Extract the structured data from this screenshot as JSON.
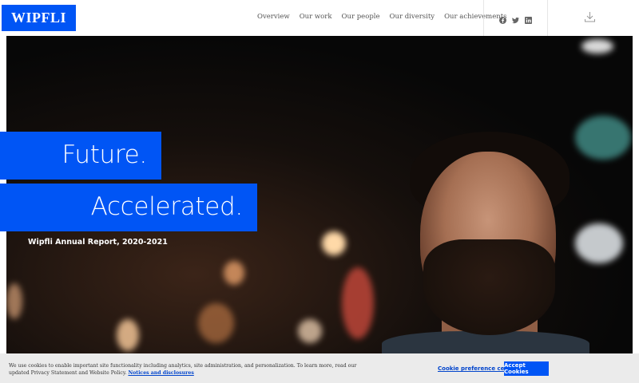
{
  "header": {
    "logo": "WIPFLI",
    "nav": [
      "Overview",
      "Our work",
      "Our people",
      "Our diversity",
      "Our achievements"
    ],
    "social_icons": [
      "facebook-icon",
      "twitter-icon",
      "linkedin-icon"
    ],
    "download_icon": "download-icon"
  },
  "hero": {
    "line1": "Future.",
    "line2": "Accelerated.",
    "subtitle": "Wipfli Annual Report, 2020-2021"
  },
  "cookie": {
    "text": "We use cookies to enable important site functionality including analytics, site administration, and personalization. To learn more, read our updated Privacy Statement and Website Policy.",
    "link": "Notices and disclosures",
    "preference": "Cookie preference center",
    "accept": "Accept Cookies"
  },
  "colors": {
    "brand_blue": "#0055f5"
  }
}
